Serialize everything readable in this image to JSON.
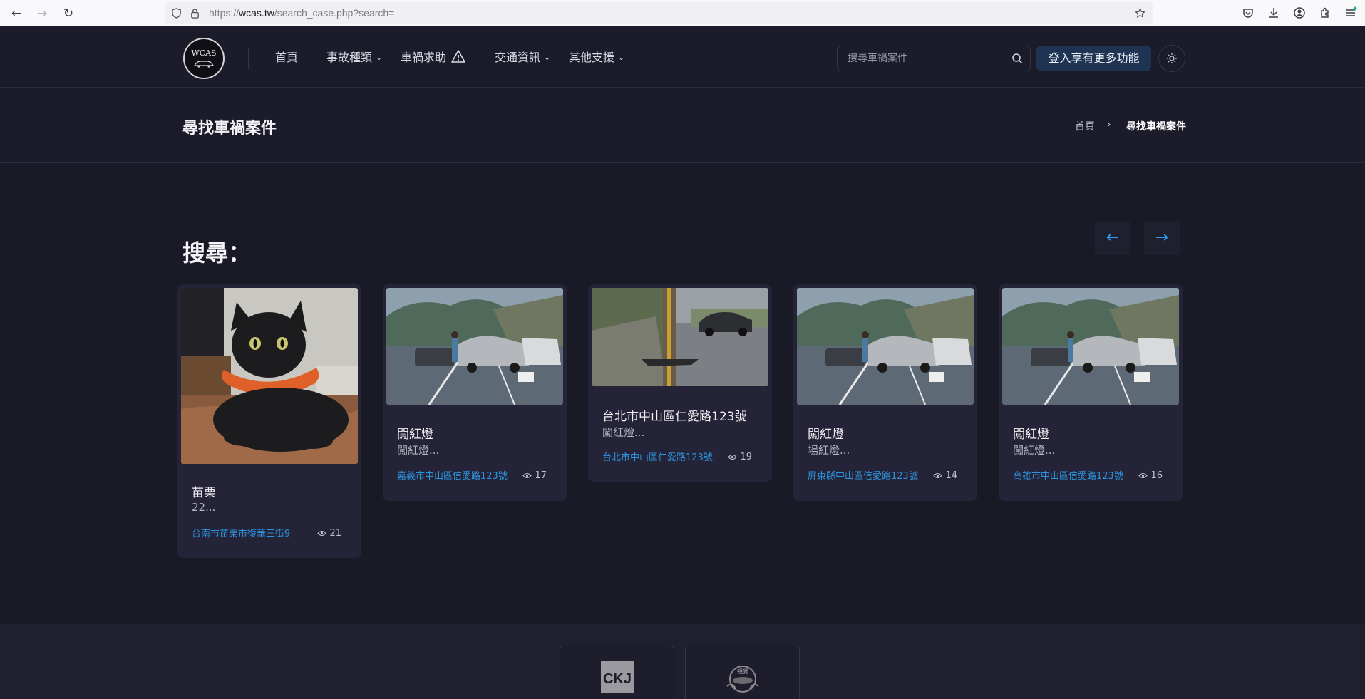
{
  "browser": {
    "url_prefix": "https://",
    "url_host": "wcas.tw",
    "url_path": "/search_case.php?search="
  },
  "header": {
    "logo_text": "WCAS",
    "menu": [
      {
        "label": "首頁"
      },
      {
        "label": "事故種類"
      },
      {
        "label": "車禍求助"
      },
      {
        "label": "交通資訊"
      },
      {
        "label": "其他支援"
      }
    ],
    "search_placeholder": "搜尋車禍案件",
    "login_label": "登入享有更多功能"
  },
  "title_bar": {
    "title": "尋找車禍案件",
    "breadcrumb": [
      "首頁",
      "尋找車禍案件"
    ]
  },
  "main": {
    "heading": "搜尋：",
    "prev_arrow": "←",
    "next_arrow": "→",
    "cards": [
      {
        "title": "苗栗",
        "desc": "22...",
        "location": "台南市苗栗市復華三街9",
        "views": "21",
        "image": "black-cat-photo"
      },
      {
        "title": "闖紅燈",
        "desc": "闖紅燈...",
        "location": "嘉義市中山區信愛路123號",
        "views": "17",
        "image": "highway-crash-photo"
      },
      {
        "title": "台北市中山區仁愛路123號",
        "desc": "闖紅燈...",
        "location": "台北市中山區仁愛路123號",
        "views": "19",
        "image": "roadside-crash-photo"
      },
      {
        "title": "闖紅燈",
        "desc": "場紅燈...",
        "location": "屏東縣中山區信愛路123號",
        "views": "14",
        "image": "highway-crash-photo"
      },
      {
        "title": "闖紅燈",
        "desc": "闖紅燈...",
        "location": "高雄市中山區信愛路123號",
        "views": "16",
        "image": "highway-crash-photo"
      }
    ]
  },
  "footer": {
    "partners": [
      {
        "logo_text": "CKJ"
      },
      {
        "logo_text": "視覺"
      }
    ]
  },
  "colors": {
    "background": "#1b1b2a",
    "card": "#242337",
    "accent_blue": "#2d95e0",
    "login_button": "#1f3352"
  }
}
